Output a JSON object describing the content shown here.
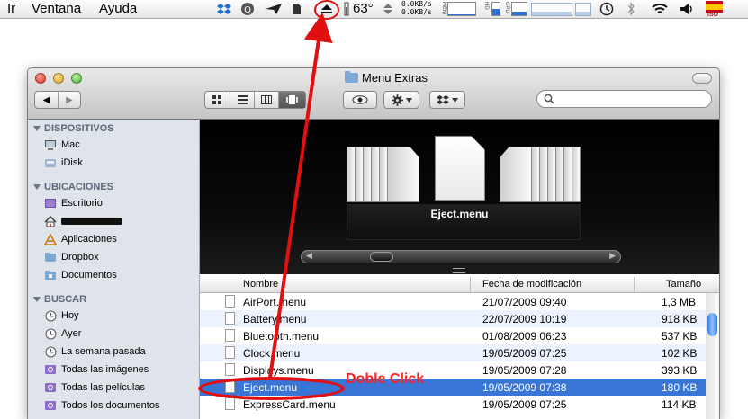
{
  "menubar": {
    "items": [
      "Ir",
      "Ventana",
      "Ayuda"
    ],
    "temperature": "63°",
    "net_up": "0.0KB/s",
    "net_down": "0.0KB/s",
    "meters": [
      {
        "label": "MEM",
        "level": 0.1
      },
      {
        "label": "HD",
        "level": 0.5
      },
      {
        "label": "CPU",
        "level": 0.3
      }
    ],
    "flag_label": "ISO",
    "status_icons": [
      "dropbox-icon",
      "quicksilver-icon",
      "paper-plane-icon",
      "evernote-icon",
      "eject-icon",
      "time-machine-icon",
      "bluetooth-icon",
      "wifi-icon",
      "volume-icon"
    ]
  },
  "window": {
    "title": "Menu Extras",
    "view_modes": [
      "icon",
      "list",
      "column",
      "coverflow"
    ],
    "active_view": "coverflow"
  },
  "sidebar": {
    "sections": [
      {
        "title": "DISPOSITIVOS",
        "items": [
          "Mac",
          "iDisk"
        ]
      },
      {
        "title": "UBICACIONES",
        "items": [
          "Escritorio",
          "",
          "Aplicaciones",
          "Dropbox",
          "Documentos"
        ]
      },
      {
        "title": "BUSCAR",
        "items": [
          "Hoy",
          "Ayer",
          "La semana pasada",
          "Todas las imágenes",
          "Todas las películas",
          "Todos los documentos"
        ]
      }
    ]
  },
  "coverflow": {
    "current_label": "Eject.menu"
  },
  "list": {
    "columns": [
      "Nombre",
      "Fecha de modificación",
      "Tamaño"
    ],
    "rows": [
      {
        "name": "AirPort.menu",
        "date": "21/07/2009 09:40",
        "size": "1,3 MB"
      },
      {
        "name": "Battery.menu",
        "date": "22/07/2009 10:19",
        "size": "918 KB"
      },
      {
        "name": "Bluetooth.menu",
        "date": "01/08/2009 06:23",
        "size": "537 KB"
      },
      {
        "name": "Clock.menu",
        "date": "19/05/2009 07:25",
        "size": "102 KB"
      },
      {
        "name": "Displays.menu",
        "date": "19/05/2009 07:28",
        "size": "393 KB"
      },
      {
        "name": "Eject.menu",
        "date": "19/05/2009 07:38",
        "size": "180 KB"
      },
      {
        "name": "ExpressCard.menu",
        "date": "19/05/2009 07:25",
        "size": "114 KB"
      }
    ],
    "selected_index": 5
  },
  "annotation": {
    "text": "Doble Click",
    "color": "#ff2020"
  }
}
